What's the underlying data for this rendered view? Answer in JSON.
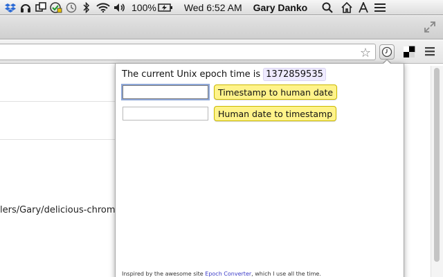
{
  "menubar": {
    "icons": [
      "dropbox-icon",
      "headphones-icon",
      "window-switch-icon",
      "shield-icon",
      "time-machine-icon",
      "bluetooth-icon",
      "wifi-icon",
      "volume-icon",
      "battery-icon",
      "home-icon",
      "font-a-icon",
      "hamburger-icon",
      "search-icon"
    ],
    "battery_percent": "100%",
    "clock": "Wed 6:52 AM",
    "user": "Gary Danko"
  },
  "toolbar": {
    "icons": [
      "star-icon",
      "clock-extension-icon",
      "delicious-icon",
      "chrome-menu-icon"
    ]
  },
  "page": {
    "path_text": "lers/Gary/delicious-chrome"
  },
  "popup": {
    "epoch_prefix": "The current Unix epoch time is",
    "epoch_value": "1372859535",
    "timestamp_input": {
      "value": "",
      "placeholder": ""
    },
    "timestamp_button": "Timestamp to human date",
    "date_input": {
      "value": "",
      "placeholder": ""
    },
    "date_button": "Human date to timestamp",
    "footer_prefix": "Inspired by the awesome site ",
    "footer_link": "Epoch Converter",
    "footer_suffix": ", which I use all the time."
  },
  "colors": {
    "button_yellow": "#fff38a",
    "epoch_badge": "#eeeaff",
    "link": "#3a3ac8"
  }
}
